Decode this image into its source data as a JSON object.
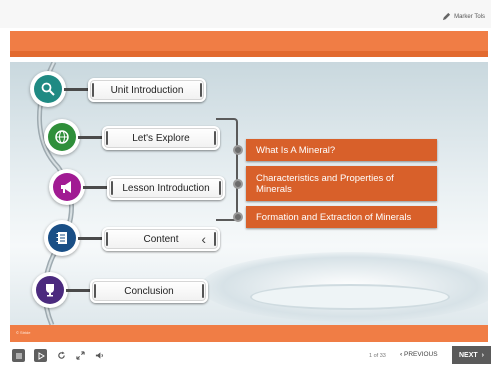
{
  "toolbar": {
    "marker_label": "Marker Tols"
  },
  "slide": {
    "copyright": "© Stride"
  },
  "menu": [
    {
      "label": "Unit Introduction",
      "icon": "magnifier-icon",
      "color": "#1f8a83"
    },
    {
      "label": "Let's Explore",
      "icon": "globe-icon",
      "color": "#2f8f3a"
    },
    {
      "label": "Lesson Introduction",
      "icon": "megaphone-icon",
      "color": "#a11b93"
    },
    {
      "label": "Content",
      "icon": "notebook-icon",
      "color": "#1a4f86",
      "expanded": true
    },
    {
      "label": "Conclusion",
      "icon": "trophy-icon",
      "color": "#4b2a7e"
    }
  ],
  "submenu": [
    {
      "label": "What Is A Mineral?"
    },
    {
      "label": "Characteristics and Properties of Minerals"
    },
    {
      "label": "Formation and Extraction of Minerals"
    }
  ],
  "player": {
    "page_info": "1 of 33",
    "prev_label": "PREVIOUS",
    "next_label": "NEXT"
  },
  "colors": {
    "accent": "#f07d45",
    "submenu_bg": "#d8602a",
    "dark_button": "#5a5a5a"
  }
}
